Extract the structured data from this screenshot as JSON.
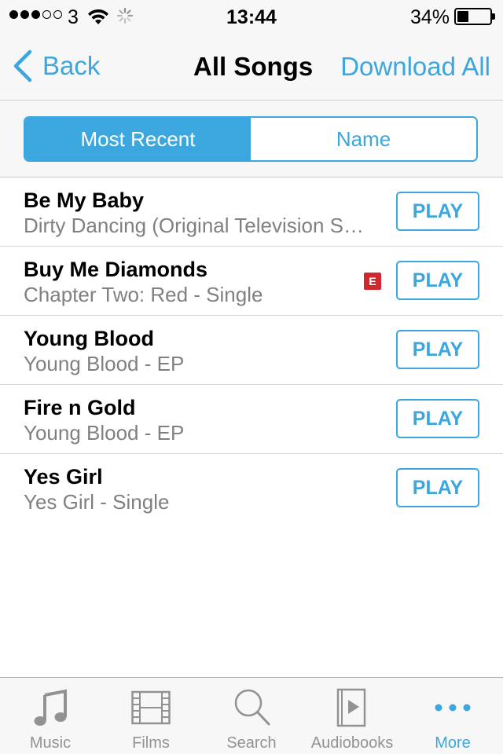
{
  "status_bar": {
    "carrier": "3",
    "time": "13:44",
    "battery_percent": "34%",
    "battery_level": 0.34,
    "signal_bars_filled": 3,
    "signal_bars_total": 5
  },
  "nav": {
    "back_label": "Back",
    "title": "All Songs",
    "download_all_label": "Download All"
  },
  "segments": [
    {
      "label": "Most Recent",
      "selected": true
    },
    {
      "label": "Name",
      "selected": false
    }
  ],
  "songs": [
    {
      "title": "Be My Baby",
      "album": "Dirty Dancing (Original Television Soundtrack)",
      "explicit": false,
      "play_label": "PLAY"
    },
    {
      "title": "Buy Me Diamonds",
      "album": "Chapter Two: Red - Single",
      "explicit": true,
      "explicit_label": "E",
      "play_label": "PLAY"
    },
    {
      "title": "Young Blood",
      "album": "Young Blood - EP",
      "explicit": false,
      "play_label": "PLAY"
    },
    {
      "title": "Fire n Gold",
      "album": "Young Blood - EP",
      "explicit": false,
      "play_label": "PLAY"
    },
    {
      "title": "Yes Girl",
      "album": "Yes Girl - Single",
      "explicit": false,
      "play_label": "PLAY"
    }
  ],
  "tabs": [
    {
      "label": "Music",
      "icon": "music-note-icon",
      "active": false
    },
    {
      "label": "Films",
      "icon": "film-strip-icon",
      "active": false
    },
    {
      "label": "Search",
      "icon": "search-icon",
      "active": false
    },
    {
      "label": "Audiobooks",
      "icon": "audiobook-icon",
      "active": false
    },
    {
      "label": "More",
      "icon": "more-dots-icon",
      "active": true
    }
  ],
  "colors": {
    "accent": "#3ba7de",
    "explicit_badge": "#d0282e",
    "inactive_tab": "#929292",
    "secondary_text": "#808080"
  }
}
